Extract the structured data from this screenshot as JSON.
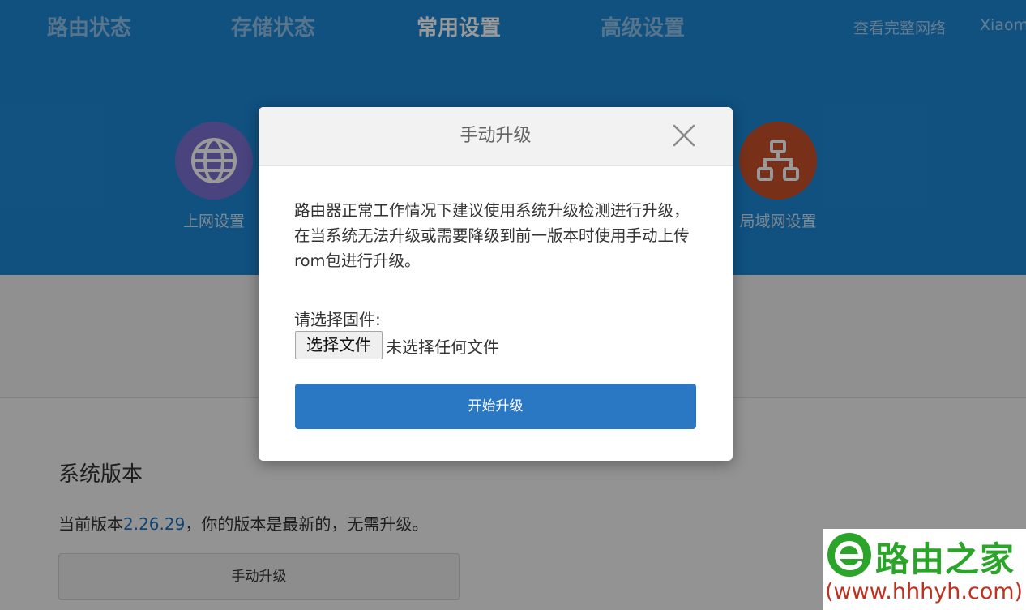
{
  "nav": {
    "items": [
      "路由状态",
      "存储状态",
      "常用设置",
      "高级设置"
    ],
    "active": "常用设置",
    "right_link": "查看完整网络",
    "user": "Xiaom"
  },
  "features": [
    {
      "label": "上网设置",
      "icon": "globe-icon",
      "color": "#7b71d2"
    },
    {
      "label": "局域网设置",
      "icon": "network-topology-icon",
      "color": "#c8502a"
    }
  ],
  "system": {
    "title": "系统版本",
    "version_prefix": "当前版本",
    "version": "2.26.29",
    "version_suffix": "，你的版本是最新的，无需升级。",
    "manual_button": "手动升级"
  },
  "modal": {
    "title": "手动升级",
    "description": "路由器正常工作情况下建议使用系统升级检测进行升级，在当系统无法升级或需要降级到前一版本时使用手动上传rom包进行升级。",
    "firmware_label": "请选择固件:",
    "choose_file_button": "选择文件",
    "no_file_text": "未选择任何文件",
    "start_button": "开始升级"
  },
  "watermark": {
    "title": "路由之家",
    "url": "(www.hhhyh.com)"
  },
  "colors": {
    "header_blue": "#1c88d6",
    "primary_button": "#2a78c3",
    "version_link": "#1a6fc4"
  }
}
